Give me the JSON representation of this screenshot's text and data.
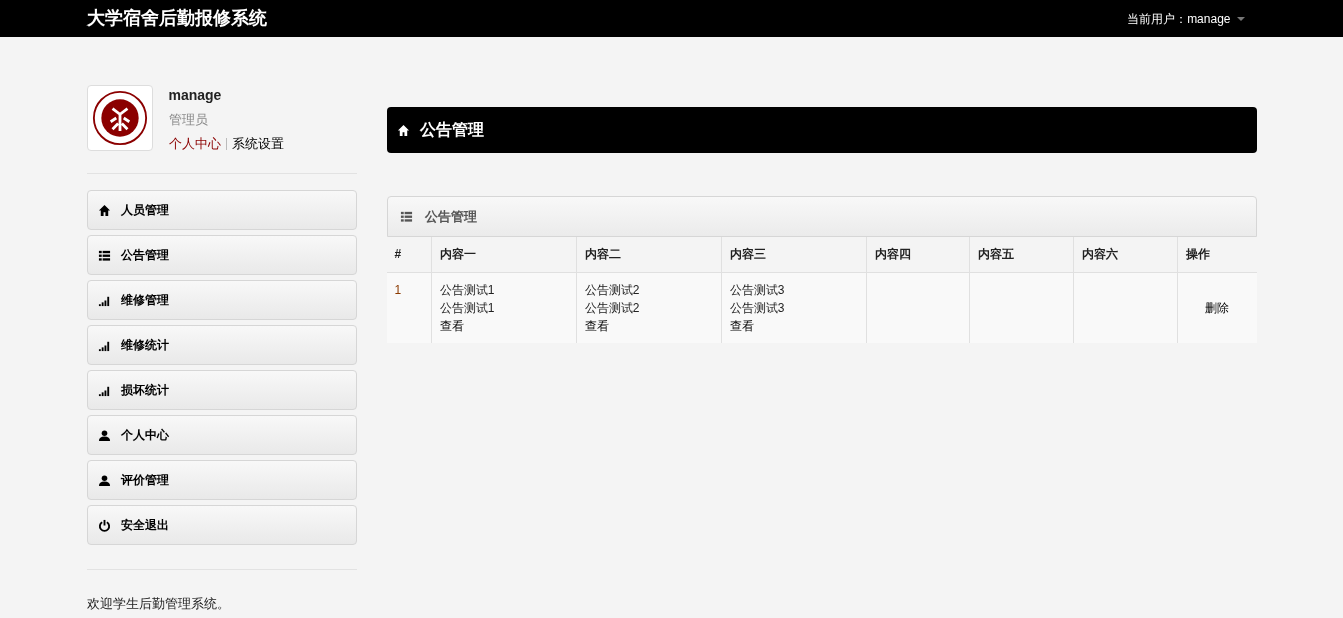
{
  "navbar": {
    "brand": "大学宿舍后勤报修系统",
    "user_menu": "当前用户：manage"
  },
  "profile": {
    "username": "manage",
    "role": "管理员",
    "links": [
      "个人中心",
      "系统设置"
    ]
  },
  "sidebar": {
    "items": [
      {
        "label": "人员管理",
        "kind": "home"
      },
      {
        "label": "公告管理",
        "kind": "list"
      },
      {
        "label": "维修管理",
        "kind": "signal"
      },
      {
        "label": "维修统计",
        "kind": "signal"
      },
      {
        "label": "损坏统计",
        "kind": "signal"
      },
      {
        "label": "个人中心",
        "kind": "user"
      },
      {
        "label": "评价管理",
        "kind": "user"
      },
      {
        "label": "安全退出",
        "kind": "power"
      }
    ]
  },
  "footer": "欢迎学生后勤管理系统。",
  "page_header": {
    "title": "公告管理"
  },
  "panel": {
    "title": "公告管理",
    "table": {
      "columns": [
        "#",
        "内容一",
        "内容二",
        "内容三",
        "内容四",
        "内容五",
        "内容六",
        "操作"
      ],
      "rows": [
        {
          "cells": [
            "1",
            {
              "lines": [
                "公告测试1",
                "公告测试1"
              ],
              "link": "查看"
            },
            {
              "lines": [
                "公告测试2",
                "公告测试2"
              ],
              "link": "查看"
            },
            {
              "lines": [
                "公告测试3",
                "公告测试3"
              ],
              "link": "查看"
            },
            "",
            "",
            "",
            "删除"
          ]
        }
      ]
    }
  }
}
